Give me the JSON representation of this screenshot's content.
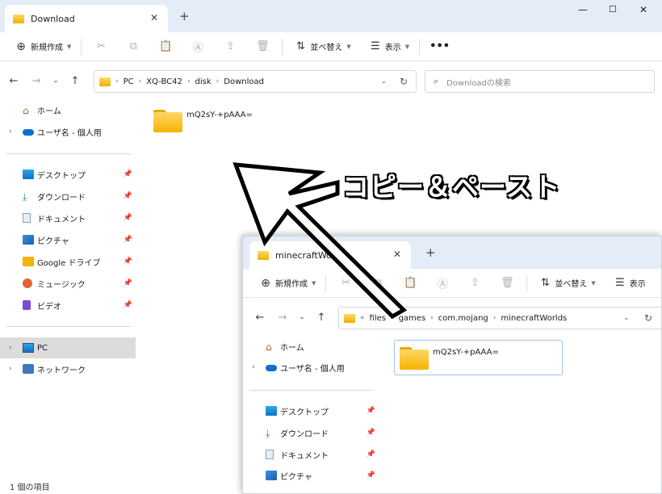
{
  "window1": {
    "tab_title": "Download",
    "toolbar": {
      "new_label": "新規作成",
      "sort_label": "並べ替え",
      "view_label": "表示"
    },
    "breadcrumb": [
      "PC",
      "XQ-BC42",
      "disk",
      "Download"
    ],
    "search_placeholder": "Downloadの検索",
    "nav": {
      "home": "ホーム",
      "user": "ユーザ名 - 個人用",
      "desktop": "デスクトップ",
      "downloads": "ダウンロード",
      "documents": "ドキュメント",
      "pictures": "ピクチャ",
      "google_drive": "Google ドライブ",
      "music": "ミュージック",
      "videos": "ビデオ",
      "pc": "PC",
      "network": "ネットワーク"
    },
    "folder_name": "mQ2sY-+pAAA=",
    "status": "1 個の項目"
  },
  "window2": {
    "tab_title": "minecraftWorlds",
    "toolbar": {
      "new_label": "新規作成",
      "sort_label": "並べ替え",
      "view_label": "表示"
    },
    "breadcrumb_prefix": "«",
    "breadcrumb": [
      "files",
      "games",
      "com.mojang",
      "minecraftWorlds"
    ],
    "nav": {
      "home": "ホーム",
      "user": "ユーザ名 - 個人用",
      "desktop": "デスクトップ",
      "downloads": "ダウンロード",
      "documents": "ドキュメント",
      "pictures": "ピクチャ"
    },
    "folder_name": "mQ2sY-+pAAA="
  },
  "annotation": {
    "caption": "コピー＆ペースト"
  },
  "colors": {
    "accent": "#e3ecf7",
    "folder": "#f4b400",
    "selection": "#dcdcdc"
  }
}
